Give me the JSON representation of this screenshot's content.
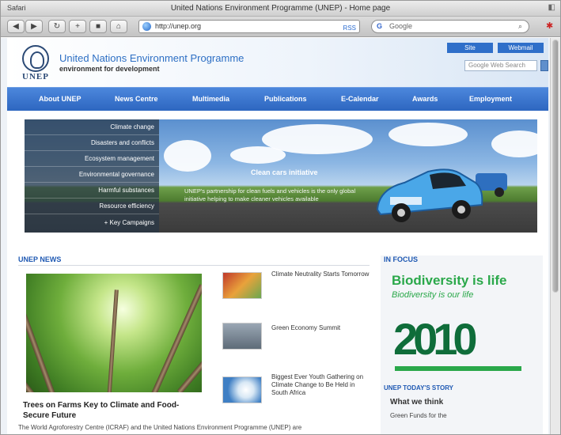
{
  "browser": {
    "app_name": "Safari",
    "window_title": "United Nations Environment Programme (UNEP) - Home page",
    "url": "http://unep.org",
    "search_placeholder": "Google"
  },
  "header": {
    "logo_text": "UNEP",
    "org_name": "United Nations Environment Programme",
    "tagline": "environment for development",
    "top_buttons": [
      "Site",
      "Webmail"
    ],
    "search_placeholder": "Google Web Search"
  },
  "nav": {
    "items": [
      "About UNEP",
      "News Centre",
      "Multimedia",
      "Publications",
      "E-Calendar",
      "Awards",
      "Employment"
    ]
  },
  "banner": {
    "menu": [
      "Climate change",
      "Disasters and conflicts",
      "Ecosystem management",
      "Environmental governance",
      "Harmful substances",
      "Resource efficiency",
      "+ Key Campaigns"
    ],
    "title": "Clean cars initiative",
    "description": "UNEP's partnership for clean fuels and vehicles is the only global initiative helping to make cleaner vehicles available"
  },
  "news": {
    "heading": "UNEP NEWS",
    "headline": "Trees on Farms Key to Climate and Food-Secure Future",
    "body": "The World Agroforestry Centre (ICRAF) and the United Nations Environment Programme (UNEP) are",
    "stories": [
      "Climate Neutrality Starts Tomorrow",
      "Green Economy Summit",
      "Biggest Ever Youth Gathering on Climate Change to Be Held in South Africa"
    ]
  },
  "sidebar": {
    "heading": "IN FOCUS",
    "bio_line1": "Biodiversity is life",
    "bio_line2": "Biodiversity is our life",
    "year": "2010",
    "heading2": "UNEP TODAY'S STORY",
    "heading3": "What we think",
    "snippet": "Green Funds for the"
  },
  "colors": {
    "nav_blue": "#2d66c0",
    "link_blue": "#1f59b3",
    "bio_green": "#2aa84a"
  }
}
